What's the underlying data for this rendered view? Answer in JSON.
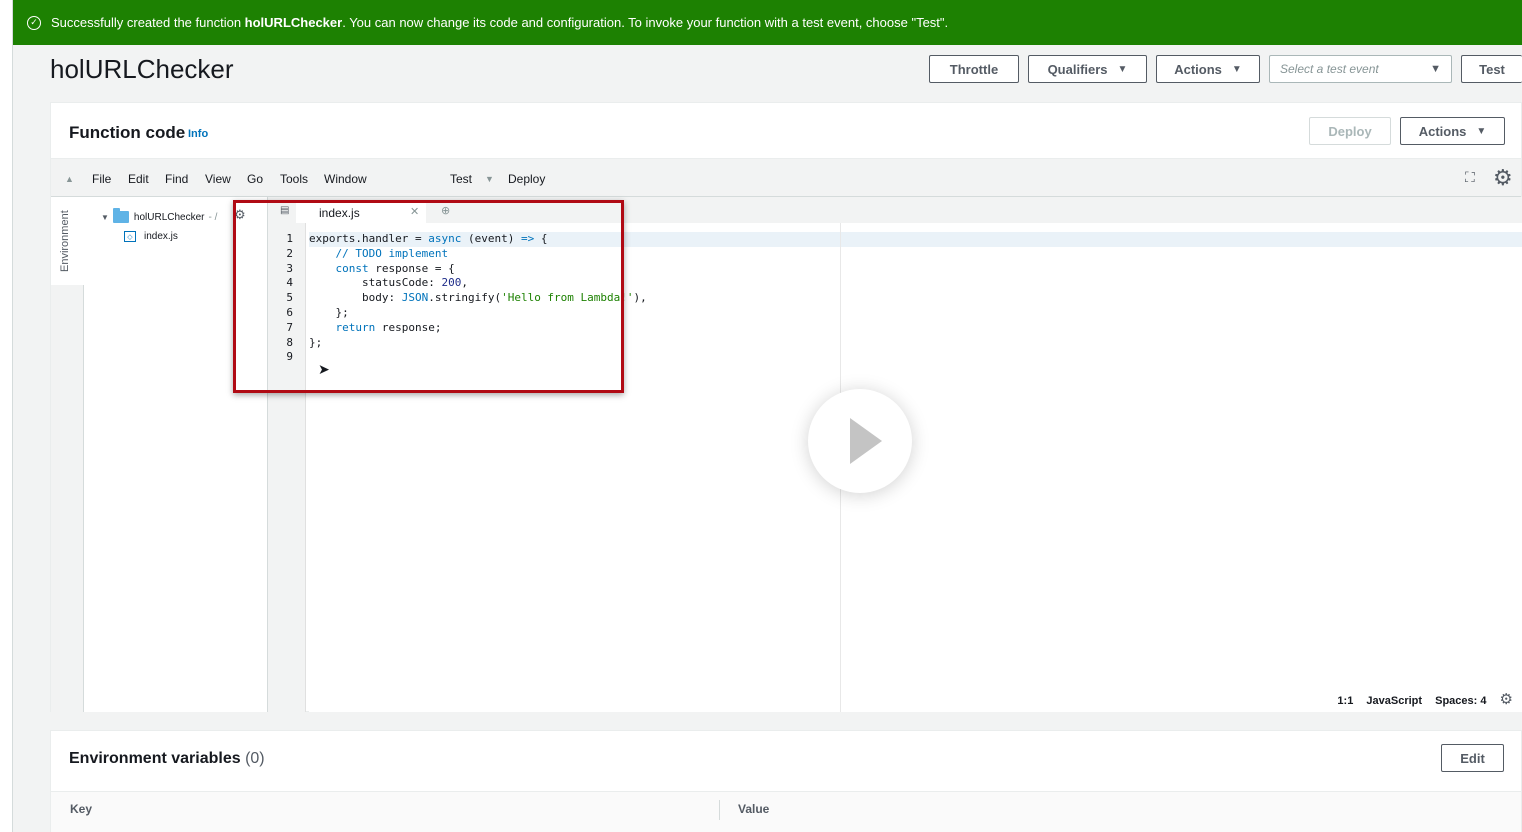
{
  "banner": {
    "text_before": "Successfully created the function ",
    "function_name": "holURLChecker",
    "text_after": ". You can now change its code and configuration. To invoke your function with a test event, choose \"Test\"."
  },
  "header": {
    "title": "holURLChecker",
    "throttle_label": "Throttle",
    "qualifiers_label": "Qualifiers",
    "actions_label": "Actions",
    "test_event_placeholder": "Select a test event",
    "test_label": "Test"
  },
  "function_code": {
    "title": "Function code",
    "info_label": "Info",
    "deploy_label": "Deploy",
    "actions_label": "Actions"
  },
  "ide_menu": {
    "items": [
      "File",
      "Edit",
      "Find",
      "View",
      "Go",
      "Tools",
      "Window"
    ],
    "test_label": "Test",
    "deploy_label": "Deploy"
  },
  "sidebar": {
    "environment_label": "Environment",
    "folder_name": "holURLChecker",
    "folder_suffix": "- /",
    "file_name": "index.js"
  },
  "editor": {
    "tab_name": "index.js",
    "line_numbers": [
      "1",
      "2",
      "3",
      "4",
      "5",
      "6",
      "7",
      "8",
      "9"
    ],
    "status": {
      "position": "1:1",
      "language": "JavaScript",
      "spaces": "Spaces: 4"
    }
  },
  "env_variables": {
    "title": "Environment variables",
    "count": "(0)",
    "edit_label": "Edit",
    "col_key": "Key",
    "col_value": "Value"
  },
  "colors": {
    "success_banner": "#1d8102",
    "link": "#0073bb",
    "highlight_box": "#b00a14"
  }
}
